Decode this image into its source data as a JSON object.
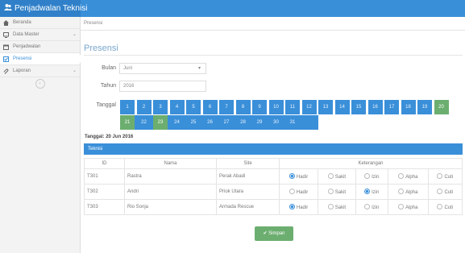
{
  "app": {
    "title": "Penjadwalan Teknisi",
    "icon": "users-icon"
  },
  "sidebar": {
    "items": [
      {
        "label": "Beranda",
        "icon": "home-icon",
        "has_chevron": false
      },
      {
        "label": "Data Master",
        "icon": "monitor-icon",
        "has_chevron": true
      },
      {
        "label": "Penjadwalan",
        "icon": "calendar-icon",
        "has_chevron": false
      },
      {
        "label": "Presensi",
        "icon": "check-square-icon",
        "has_chevron": false,
        "active": true
      },
      {
        "label": "Laporan",
        "icon": "paperclip-icon",
        "has_chevron": true
      }
    ],
    "collapse_icon": "chevron-left-circle-icon"
  },
  "breadcrumb": "Presensi",
  "page_title": "Presensi",
  "form": {
    "bulan_label": "Bulan",
    "bulan_value": "Juni",
    "tahun_label": "Tahun",
    "tahun_value": "2016",
    "tanggal_label": "Tanggal"
  },
  "calendar": {
    "days": [
      "1",
      "2",
      "3",
      "4",
      "5",
      "6",
      "7",
      "8",
      "9",
      "10",
      "11",
      "12",
      "13",
      "14",
      "15",
      "16",
      "17",
      "18",
      "19",
      "20",
      "21",
      "22",
      "23",
      "24",
      "25",
      "26",
      "27",
      "28",
      "29",
      "30",
      "31"
    ],
    "highlighted": [
      "20",
      "21",
      "23"
    ]
  },
  "selected_date_label": "Tanggal: 20 Jun 2016",
  "panel_title": "Teknisi",
  "table": {
    "headers": [
      "ID",
      "Nama",
      "Site",
      "Keterangan"
    ],
    "options": [
      "Hadir",
      "Sakit",
      "Izin",
      "Alpha",
      "Cuti"
    ],
    "rows": [
      {
        "id": "T301",
        "nama": "Rastra",
        "site": "Perak Abadi",
        "selected": "Hadir"
      },
      {
        "id": "T302",
        "nama": "Andri",
        "site": "Priok Utara",
        "selected": "Izin"
      },
      {
        "id": "T303",
        "nama": "Rio Sonja",
        "site": "Armada Rescue",
        "selected": "Hadir"
      }
    ]
  },
  "save_button": "Simpan",
  "colors": {
    "primary": "#3a8fd9",
    "success": "#6cae70"
  }
}
